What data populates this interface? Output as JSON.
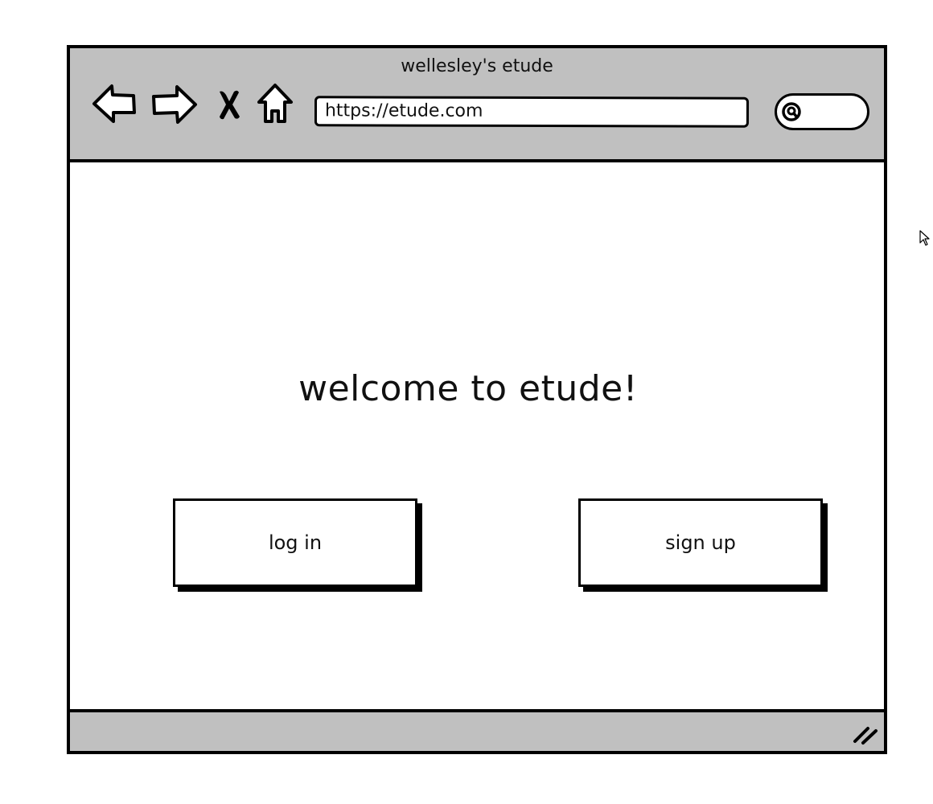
{
  "window": {
    "title": "wellesley's etude"
  },
  "toolbar": {
    "icons": [
      "back-arrow-icon",
      "forward-arrow-icon",
      "stop-icon",
      "home-icon"
    ],
    "url": "https://etude.com",
    "search_icon": "search-icon"
  },
  "main": {
    "heading": "welcome to etude!",
    "login_label": "log in",
    "signup_label": "sign up"
  },
  "statusbar": {
    "grip_icon": "resize-grip-icon"
  },
  "colors": {
    "chrome": "#c0c0c0",
    "border": "#000000",
    "background": "#ffffff"
  }
}
